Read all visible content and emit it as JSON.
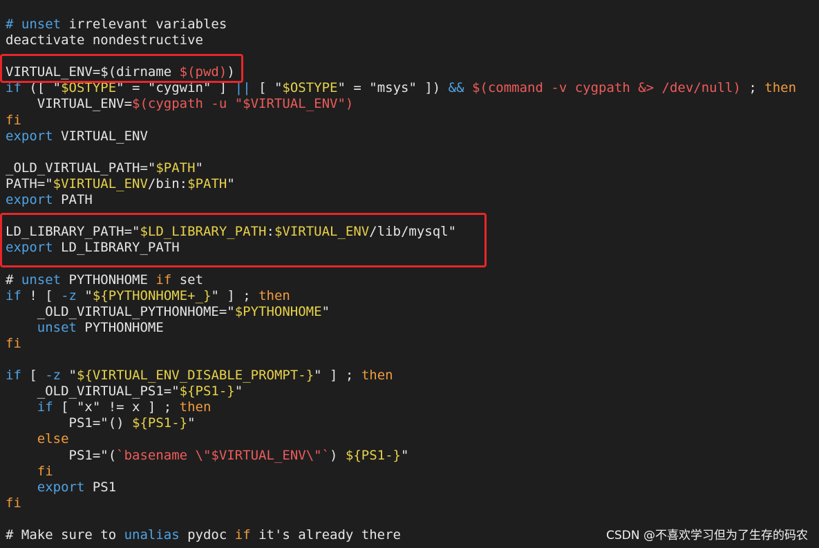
{
  "code_lines": [
    [
      [
        "b",
        "# "
      ],
      [
        "b",
        "unset"
      ],
      [
        "w",
        " irrelevant variables"
      ]
    ],
    [
      [
        "w",
        "deactivate nondestructive"
      ]
    ],
    [
      [
        "w",
        ""
      ]
    ],
    [
      [
        "w",
        "VIRTUAL_ENV=$(dirname "
      ],
      [
        "r",
        "$(pwd)"
      ],
      [
        "w",
        ")"
      ]
    ],
    [
      [
        "b",
        "if"
      ],
      [
        "w",
        " ([ \""
      ],
      [
        "y",
        "$OSTYPE"
      ],
      [
        "w",
        "\" = \"cygwin\" ] "
      ],
      [
        "b",
        "||"
      ],
      [
        "w",
        " [ \""
      ],
      [
        "y",
        "$OSTYPE"
      ],
      [
        "w",
        "\" = \"msys\" ]) "
      ],
      [
        "b",
        "&&"
      ],
      [
        "r",
        " $(command -v cygpath &> /dev/null)"
      ],
      [
        "w",
        " ; "
      ],
      [
        "o",
        "then"
      ]
    ],
    [
      [
        "w",
        "    VIRTUAL_ENV="
      ],
      [
        "r",
        "$(cygpath -u \"$VIRTUAL_ENV\")"
      ]
    ],
    [
      [
        "o",
        "fi"
      ]
    ],
    [
      [
        "b",
        "export"
      ],
      [
        "w",
        " VIRTUAL_ENV"
      ]
    ],
    [
      [
        "w",
        ""
      ]
    ],
    [
      [
        "w",
        "_OLD_VIRTUAL_PATH=\""
      ],
      [
        "y",
        "$PATH"
      ],
      [
        "w",
        "\""
      ]
    ],
    [
      [
        "w",
        "PATH=\""
      ],
      [
        "y",
        "$VIRTUAL_ENV"
      ],
      [
        "w",
        "/bin:"
      ],
      [
        "y",
        "$PATH"
      ],
      [
        "w",
        "\""
      ]
    ],
    [
      [
        "b",
        "export"
      ],
      [
        "w",
        " PATH"
      ]
    ],
    [
      [
        "w",
        ""
      ]
    ],
    [
      [
        "w",
        "LD_LIBRARY_PATH=\""
      ],
      [
        "y",
        "$LD_LIBRARY_PATH"
      ],
      [
        "w",
        ":"
      ],
      [
        "y",
        "$VIRTUAL_ENV"
      ],
      [
        "w",
        "/lib/mysql\""
      ]
    ],
    [
      [
        "b",
        "export"
      ],
      [
        "w",
        " LD_LIBRARY_PATH"
      ]
    ],
    [
      [
        "w",
        ""
      ]
    ],
    [
      [
        "w",
        "# "
      ],
      [
        "b",
        "unset"
      ],
      [
        "w",
        " PYTHONHOME "
      ],
      [
        "o",
        "if"
      ],
      [
        "w",
        " set"
      ]
    ],
    [
      [
        "b",
        "if"
      ],
      [
        "w",
        " ! [ "
      ],
      [
        "b",
        "-z"
      ],
      [
        "w",
        " \""
      ],
      [
        "y",
        "${PYTHONHOME+_}"
      ],
      [
        "w",
        "\" ] ; "
      ],
      [
        "o",
        "then"
      ]
    ],
    [
      [
        "w",
        "    _OLD_VIRTUAL_PYTHONHOME=\""
      ],
      [
        "y",
        "$PYTHONHOME"
      ],
      [
        "w",
        "\""
      ]
    ],
    [
      [
        "b",
        "    unset"
      ],
      [
        "w",
        " PYTHONHOME"
      ]
    ],
    [
      [
        "o",
        "fi"
      ]
    ],
    [
      [
        "w",
        ""
      ]
    ],
    [
      [
        "b",
        "if"
      ],
      [
        "w",
        " [ "
      ],
      [
        "b",
        "-z"
      ],
      [
        "w",
        " \""
      ],
      [
        "y",
        "${VIRTUAL_ENV_DISABLE_PROMPT-}"
      ],
      [
        "w",
        "\" ] ; "
      ],
      [
        "o",
        "then"
      ]
    ],
    [
      [
        "w",
        "    _OLD_VIRTUAL_PS1=\""
      ],
      [
        "y",
        "${PS1-}"
      ],
      [
        "w",
        "\""
      ]
    ],
    [
      [
        "b",
        "    if"
      ],
      [
        "w",
        " [ \"x\" != x ] ; "
      ],
      [
        "o",
        "then"
      ]
    ],
    [
      [
        "w",
        "        PS1=\"() "
      ],
      [
        "y",
        "${PS1-}"
      ],
      [
        "w",
        "\""
      ]
    ],
    [
      [
        "o",
        "    else"
      ]
    ],
    [
      [
        "w",
        "        PS1=\"("
      ],
      [
        "r",
        "`basename \\\"$VIRTUAL_ENV\\\"`"
      ],
      [
        "w",
        ") "
      ],
      [
        "y",
        "${PS1-}"
      ],
      [
        "w",
        "\""
      ]
    ],
    [
      [
        "o",
        "    fi"
      ]
    ],
    [
      [
        "b",
        "    export"
      ],
      [
        "w",
        " PS1"
      ]
    ],
    [
      [
        "o",
        "fi"
      ]
    ],
    [
      [
        "w",
        ""
      ]
    ],
    [
      [
        "w",
        "# Make sure to "
      ],
      [
        "b",
        "unalias"
      ],
      [
        "w",
        " pydoc "
      ],
      [
        "o",
        "if"
      ],
      [
        "w",
        " it's already there"
      ]
    ]
  ],
  "watermark": "CSDN @不喜欢学习但为了生存的码农",
  "colors": {
    "background": "#1e1e1e",
    "text": "#e6e6e6",
    "keyword_blue": "#4fa3e6",
    "variable_yellow": "#e8d24a",
    "control_orange": "#f39c3d",
    "subshell_red": "#ef5b5b",
    "highlight_box": "#e8262a"
  }
}
